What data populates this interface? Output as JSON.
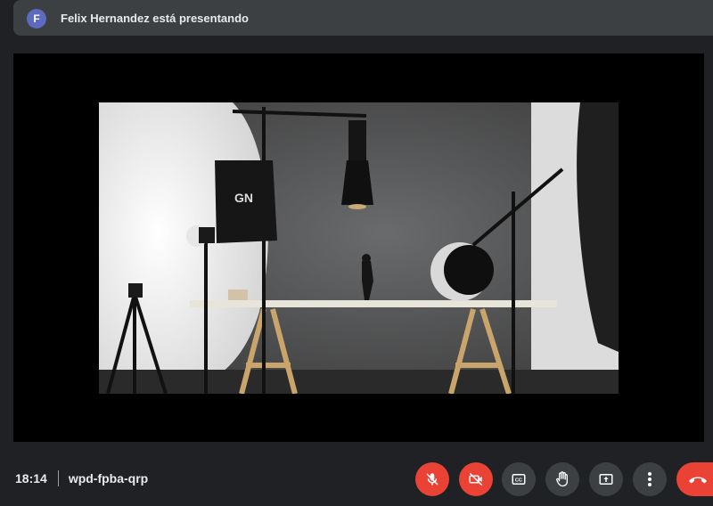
{
  "presenter_banner": {
    "avatar_letter": "F",
    "text": "Felix Hernandez está presentando"
  },
  "meeting": {
    "time": "18:14",
    "code": "wpd-fpba-qrp"
  },
  "controls": [
    {
      "name": "mic-off",
      "state": "off"
    },
    {
      "name": "camera-off",
      "state": "off"
    },
    {
      "name": "captions"
    },
    {
      "name": "raise-hand"
    },
    {
      "name": "present-screen"
    },
    {
      "name": "more-options"
    },
    {
      "name": "leave-call"
    }
  ],
  "colors": {
    "background": "#202124",
    "banner": "#3c4043",
    "avatar": "#5c6bc0",
    "danger": "#ea4335",
    "control": "#3c4043"
  }
}
